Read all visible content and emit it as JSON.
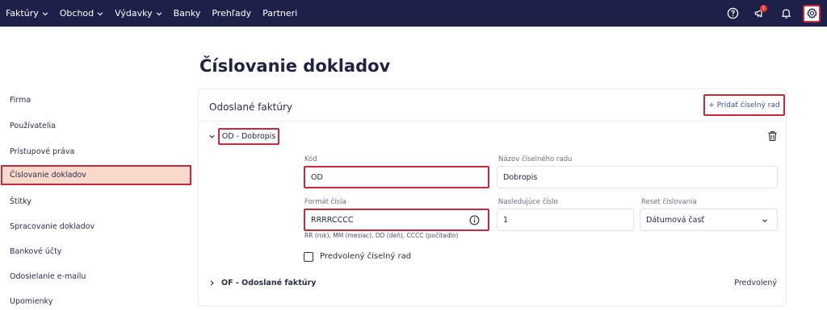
{
  "nav": {
    "items": [
      {
        "label": "Faktúry",
        "has_dropdown": true
      },
      {
        "label": "Obchod",
        "has_dropdown": true
      },
      {
        "label": "Výdavky",
        "has_dropdown": true
      },
      {
        "label": "Banky",
        "has_dropdown": false
      },
      {
        "label": "Prehľady",
        "has_dropdown": false
      },
      {
        "label": "Partneri",
        "has_dropdown": false
      }
    ],
    "notifications_badge": "1",
    "icons": [
      "help-circle-icon",
      "megaphone-icon",
      "bell-icon",
      "gear-icon"
    ],
    "bg_color": "#1d2149"
  },
  "sidebar": {
    "items": [
      {
        "label": "Firma"
      },
      {
        "label": "Používatelia"
      },
      {
        "label": "Prístupové práva"
      },
      {
        "label": "Číslovanie dokladov",
        "selected": true
      },
      {
        "label": "Štítky"
      },
      {
        "label": "Spracovanie dokladov"
      },
      {
        "label": "Bankové účty"
      },
      {
        "label": "Odosielanie e-mailu"
      },
      {
        "label": "Upomienky"
      }
    ],
    "selected_bg": "#f8d9cc"
  },
  "page": {
    "title": "Číslovanie dokladov"
  },
  "card": {
    "title": "Odoslané faktúry",
    "add_button": "+ Pridať číselný rad",
    "series": [
      {
        "tag": "OD - Dobropis",
        "expanded": true,
        "fields": {
          "code_label": "Kód",
          "code_value": "OD",
          "name_label": "Názov číselného radu",
          "name_value": "Dobropis",
          "format_label": "Formát čísla",
          "format_value": "RRRRCCCC",
          "format_hint": "RR (rok), MM (mesiac), DD (deň), CCCC (počítadlo)",
          "next_label": "Nasledujúce číslo",
          "next_value": "1",
          "reset_label": "Reset číslovania",
          "reset_value": "Dátumová časť"
        },
        "default_checkbox_label": "Predvolený číselný rad",
        "default_checked": false
      },
      {
        "tag": "OF - Odoslané faktúry",
        "expanded": false,
        "default_label": "Predvolený"
      }
    ]
  },
  "colors": {
    "highlight": "#c8283b",
    "accent": "#3d4db7"
  }
}
